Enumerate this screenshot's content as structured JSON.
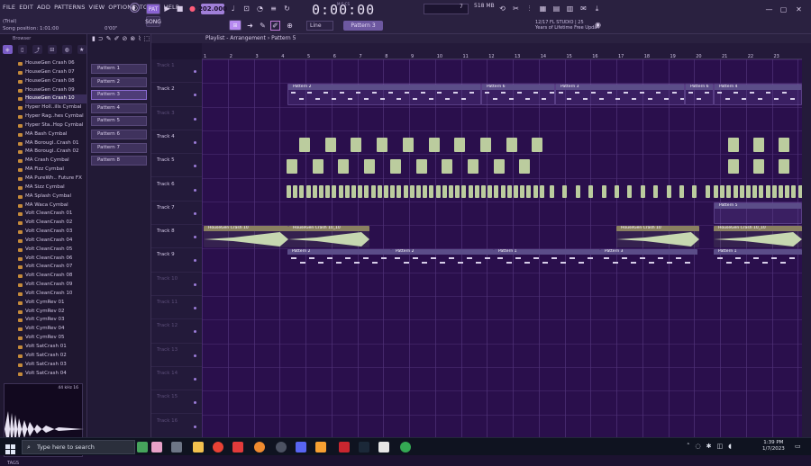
{
  "menu": [
    "FILE",
    "EDIT",
    "ADD",
    "PATTERNS",
    "VIEW",
    "OPTIONS",
    "TOOLS",
    "HELP"
  ],
  "status": {
    "trial": "(Trial)",
    "song_position": "Song position: 1:01:00"
  },
  "transport": {
    "pat_label": "PAT",
    "song_label": "SONG",
    "tempo": "202.000",
    "time": "0:00:00",
    "time_sub": "M:S:CS",
    "memory": "518 MB",
    "counter": "7",
    "snap": "Line",
    "pattern_select": "Pattern 3",
    "time2": "0'00\""
  },
  "news": {
    "date": "12/17",
    "product": "FL STUDIO | 25",
    "headline": "Years of Lifetime Free Upda.."
  },
  "browser": {
    "title": "Browser",
    "items": [
      "HouseGen Crash 06",
      "HouseGen Crash 07",
      "HouseGen Crash 08",
      "HouseGen Crash 09",
      "HouseGen Crash 10",
      "Hyper Holl..ills Cymbal",
      "Hyper Rag..hes Cymbal",
      "Hyper Sta..Hop Cymbal",
      "MA Bash Cymbal",
      "MA Borougl..Crash 01",
      "MA Borougl..Crash 02",
      "MA Crash Cymbal",
      "MA Fizz Cymbal",
      "MA PureWh.. Future FX",
      "MA Sizz Cymbal",
      "MA Splash Cymbal",
      "MA Waca Cymbal",
      "Volt CleanCrash 01",
      "Volt CleanCrash 02",
      "Volt CleanCrash 03",
      "Volt CleanCrash 04",
      "Volt CleanCrash 05",
      "Volt CleanCrash 06",
      "Volt CleanCrash 07",
      "Volt CleanCrash 08",
      "Volt CleanCrash 09",
      "Volt CleanCrash 10",
      "Volt CymRev 01",
      "Volt CymRev 02",
      "Volt CymRev 03",
      "Volt CymRev 04",
      "Volt CymRev 05",
      "Volt SatCrash 01",
      "Volt SatCrash 02",
      "Volt SatCrash 03",
      "Volt SatCrash 04"
    ],
    "selected_index": 4,
    "preview_info": "44 kHz 16",
    "tags_label": "TAGS"
  },
  "patterns": [
    "Pattern 1",
    "Pattern 2",
    "Pattern 3",
    "Pattern 4",
    "Pattern 5",
    "Pattern 6",
    "Pattern 7",
    "Pattern 8"
  ],
  "selected_pattern_index": 2,
  "playlist": {
    "title": "Playlist - Arrangement › Pattern 5",
    "bars": [
      "1",
      "2",
      "3",
      "4",
      "5",
      "6",
      "7",
      "8",
      "9",
      "10",
      "11",
      "12",
      "13",
      "14",
      "15",
      "16",
      "17",
      "18",
      "19",
      "20",
      "21",
      "22",
      "23"
    ],
    "tracks": [
      "Track 1",
      "Track 2",
      "Track 3",
      "Track 4",
      "Track 5",
      "Track 6",
      "Track 7",
      "Track 8",
      "Track 9",
      "Track 10",
      "Track 11",
      "Track 12",
      "Track 13",
      "Track 14",
      "Track 15",
      "Track 16"
    ],
    "clips": {
      "track2": [
        "Pattern 2",
        "Pattern 6",
        "Pattern 3",
        "Pattern 6",
        "Pattern 4"
      ],
      "track7": "Pattern 5",
      "track8": [
        "HouseGen Crash 10",
        "HouseGen Crash 10_10",
        "HouseGen Crash 10",
        "HouseGen Crash 10_10"
      ],
      "track9": [
        "Pattern 2",
        "Pattern 2",
        "Pattern 1",
        "Pattern 3",
        "Pattern 1"
      ]
    }
  },
  "taskbar": {
    "search_placeholder": "Type here to search",
    "time": "1:39 PM",
    "date": "1/7/2023"
  }
}
